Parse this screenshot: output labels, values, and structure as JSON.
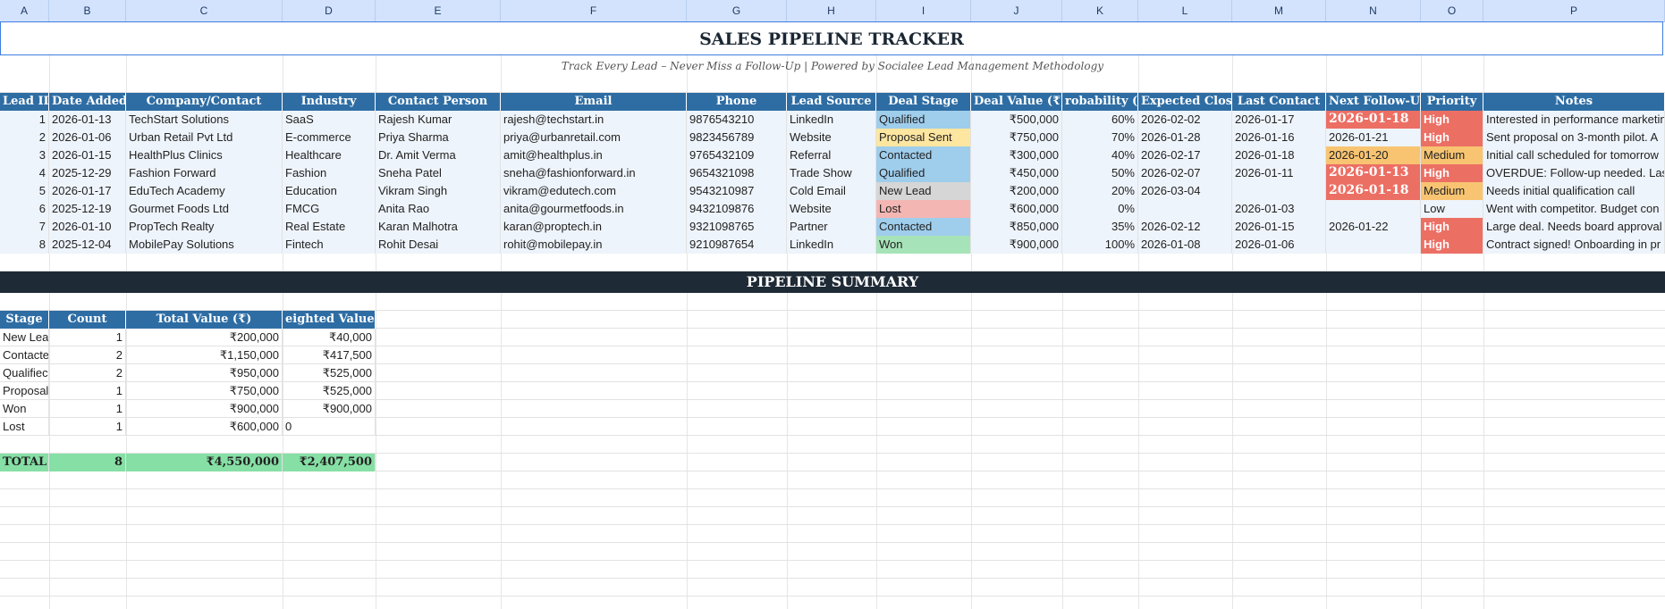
{
  "columns": [
    "A",
    "B",
    "C",
    "D",
    "E",
    "F",
    "G",
    "H",
    "I",
    "J",
    "K",
    "L",
    "M",
    "N",
    "O",
    "P"
  ],
  "title": "SALES PIPELINE TRACKER",
  "subtitle": "Track Every Lead – Never Miss a Follow-Up | Powered by Socialee Lead Management Methodology",
  "table_headers": [
    "Lead ID",
    "Date Added",
    "Company/Contact",
    "Industry",
    "Contact Person",
    "Email",
    "Phone",
    "Lead Source",
    "Deal Stage",
    "Deal Value (₹)",
    "robability (%",
    "Expected Close",
    "Last Contact",
    "Next Follow-Up",
    "Priority",
    "Notes"
  ],
  "leads": [
    {
      "id": "1",
      "date": "2026-01-13",
      "company": "TechStart Solutions",
      "industry": "SaaS",
      "contact": "Rajesh Kumar",
      "email": "rajesh@techstart.in",
      "phone": "9876543210",
      "source": "LinkedIn",
      "stage": "Qualified",
      "value": "₹500,000",
      "prob": "60%",
      "close": "2026-02-02",
      "last": "2026-01-17",
      "next": "2026-01-18",
      "priority": "High",
      "notes": "Interested in performance marketing"
    },
    {
      "id": "2",
      "date": "2026-01-06",
      "company": "Urban Retail Pvt Ltd",
      "industry": "E-commerce",
      "contact": "Priya Sharma",
      "email": "priya@urbanretail.com",
      "phone": "9823456789",
      "source": "Website",
      "stage": "Proposal Sent",
      "value": "₹750,000",
      "prob": "70%",
      "close": "2026-01-28",
      "last": "2026-01-16",
      "next": "2026-01-21",
      "priority": "High",
      "notes": "Sent proposal on 3-month pilot. A"
    },
    {
      "id": "3",
      "date": "2026-01-15",
      "company": "HealthPlus Clinics",
      "industry": "Healthcare",
      "contact": "Dr. Amit Verma",
      "email": "amit@healthplus.in",
      "phone": "9765432109",
      "source": "Referral",
      "stage": "Contacted",
      "value": "₹300,000",
      "prob": "40%",
      "close": "2026-02-17",
      "last": "2026-01-18",
      "next": "2026-01-20",
      "priority": "Medium",
      "notes": "Initial call scheduled for tomorrow"
    },
    {
      "id": "4",
      "date": "2025-12-29",
      "company": "Fashion Forward",
      "industry": "Fashion",
      "contact": "Sneha Patel",
      "email": "sneha@fashionforward.in",
      "phone": "9654321098",
      "source": "Trade Show",
      "stage": "Qualified",
      "value": "₹450,000",
      "prob": "50%",
      "close": "2026-02-07",
      "last": "2026-01-11",
      "next": "2026-01-13",
      "priority": "High",
      "notes": "OVERDUE: Follow-up needed. Last"
    },
    {
      "id": "5",
      "date": "2026-01-17",
      "company": "EduTech Academy",
      "industry": "Education",
      "contact": "Vikram Singh",
      "email": "vikram@edutech.com",
      "phone": "9543210987",
      "source": "Cold Email",
      "stage": "New Lead",
      "value": "₹200,000",
      "prob": "20%",
      "close": "2026-03-04",
      "last": "",
      "next": "2026-01-18",
      "priority": "Medium",
      "notes": "Needs initial qualification call"
    },
    {
      "id": "6",
      "date": "2025-12-19",
      "company": "Gourmet Foods Ltd",
      "industry": "FMCG",
      "contact": "Anita Rao",
      "email": "anita@gourmetfoods.in",
      "phone": "9432109876",
      "source": "Website",
      "stage": "Lost",
      "value": "₹600,000",
      "prob": "0%",
      "close": "",
      "last": "2026-01-03",
      "next": "",
      "priority": "Low",
      "notes": "Went with competitor. Budget con"
    },
    {
      "id": "7",
      "date": "2026-01-10",
      "company": "PropTech Realty",
      "industry": "Real Estate",
      "contact": "Karan Malhotra",
      "email": "karan@proptech.in",
      "phone": "9321098765",
      "source": "Partner",
      "stage": "Contacted",
      "value": "₹850,000",
      "prob": "35%",
      "close": "2026-02-12",
      "last": "2026-01-15",
      "next": "2026-01-22",
      "priority": "High",
      "notes": "Large deal. Needs board approval"
    },
    {
      "id": "8",
      "date": "2025-12-04",
      "company": "MobilePay Solutions",
      "industry": "Fintech",
      "contact": "Rohit Desai",
      "email": "rohit@mobilepay.in",
      "phone": "9210987654",
      "source": "LinkedIn",
      "stage": "Won",
      "value": "₹900,000",
      "prob": "100%",
      "close": "2026-01-08",
      "last": "2026-01-06",
      "next": "",
      "priority": "High",
      "notes": "Contract signed! Onboarding in pr"
    }
  ],
  "summary_title": "PIPELINE SUMMARY",
  "summary_headers": [
    "Stage",
    "Count",
    "Total Value (₹)",
    "eighted Value (₹"
  ],
  "summary_rows": [
    {
      "stage": "New Lea",
      "count": "1",
      "total": "₹200,000",
      "weighted": "₹40,000"
    },
    {
      "stage": "Contacte",
      "count": "2",
      "total": "₹1,150,000",
      "weighted": "₹417,500"
    },
    {
      "stage": "Qualifiec",
      "count": "2",
      "total": "₹950,000",
      "weighted": "₹525,000"
    },
    {
      "stage": "Proposal",
      "count": "1",
      "total": "₹750,000",
      "weighted": "₹525,000"
    },
    {
      "stage": "Won",
      "count": "1",
      "total": "₹900,000",
      "weighted": "₹900,000"
    },
    {
      "stage": "Lost",
      "count": "1",
      "total": "₹600,000",
      "weighted": "0"
    }
  ],
  "summary_total": {
    "label": "TOTAL I",
    "count": "8",
    "total": "₹4,550,000",
    "weighted": "₹2,407,500"
  }
}
